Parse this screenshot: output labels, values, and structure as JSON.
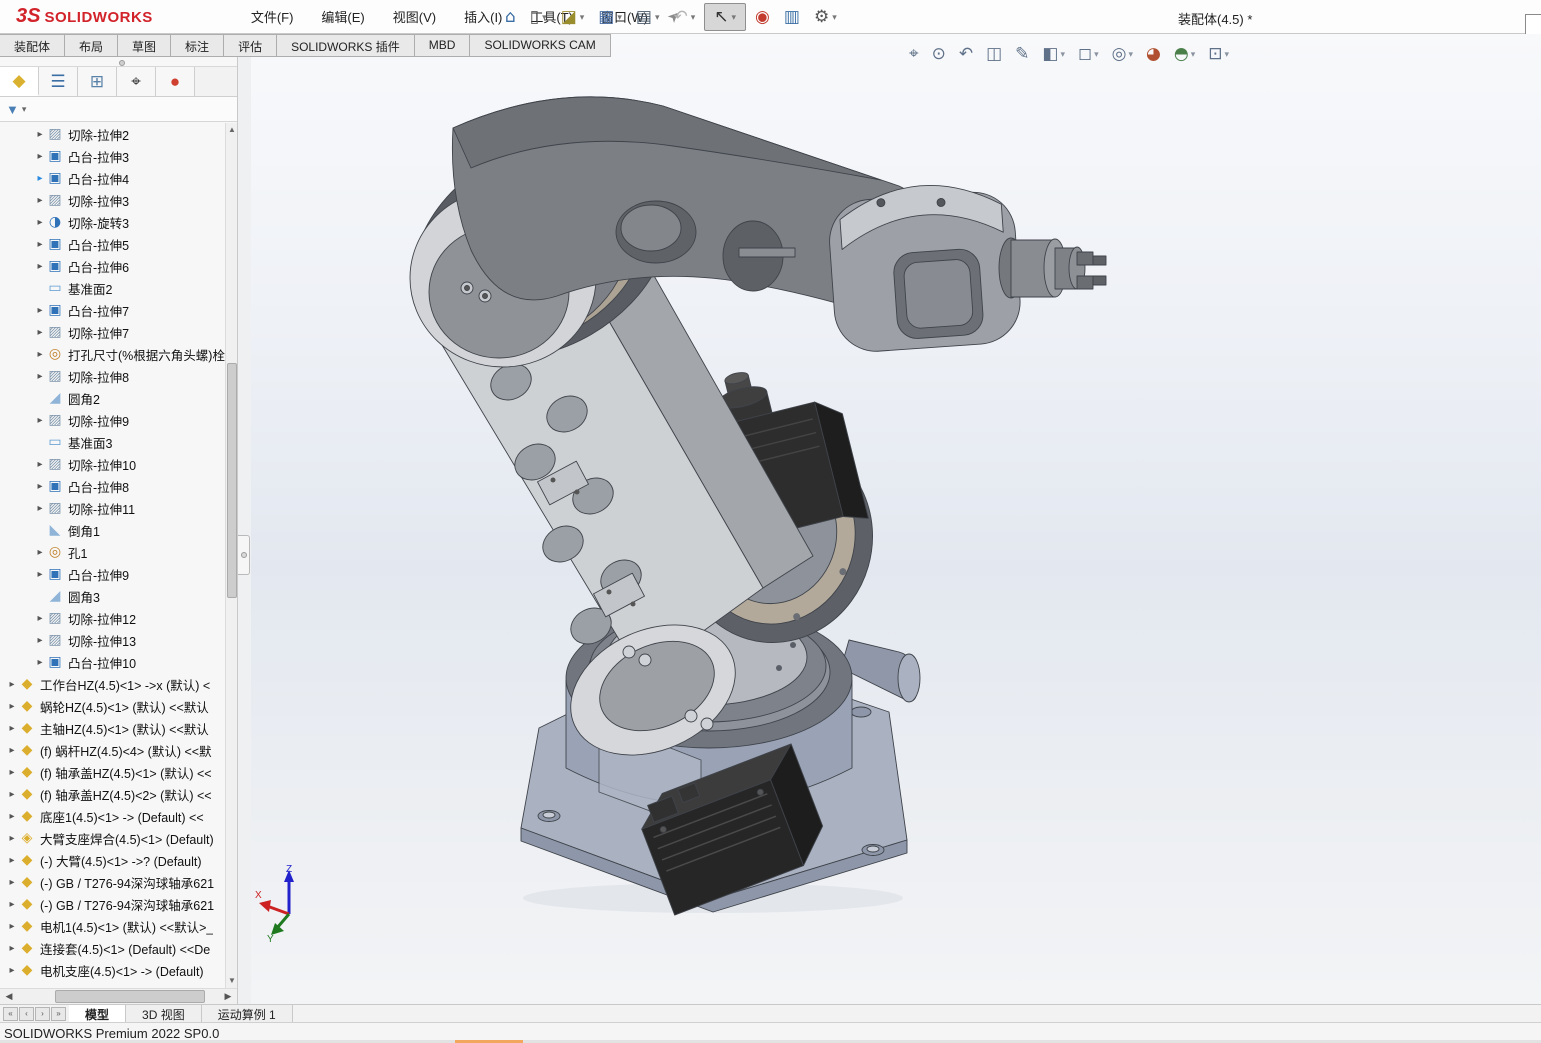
{
  "app": {
    "logo_mark": "3S",
    "logo_word": "SOLIDWORKS",
    "doc_title": "装配体(4.5) *",
    "status_text": "SOLIDWORKS Premium 2022 SP0.0",
    "accent_red": "#d2232a",
    "taskbar_accent": "#f2a65e"
  },
  "menu": {
    "items": [
      {
        "label": "文件(F)"
      },
      {
        "label": "编辑(E)"
      },
      {
        "label": "视图(V)"
      },
      {
        "label": "插入(I)"
      },
      {
        "label": "工具(T)"
      },
      {
        "label": "窗口(W)"
      }
    ],
    "pin_icon": "pin"
  },
  "quick_toolbar": {
    "buttons": [
      {
        "name": "home",
        "glyph": "⌂",
        "color": "#3a6ea5",
        "dropdown": false
      },
      {
        "name": "new-document",
        "glyph": "▯",
        "color": "#5a5a5a",
        "dropdown": true
      },
      {
        "name": "open-folder",
        "glyph": "◪",
        "color": "#9a8d2e",
        "dropdown": true
      },
      {
        "name": "save",
        "glyph": "▦",
        "color": "#4a6fa5",
        "dropdown": true
      },
      {
        "name": "print",
        "glyph": "▤",
        "color": "#49596b",
        "dropdown": true
      },
      {
        "name": "undo",
        "glyph": "↶",
        "color": "#b4b4b4",
        "dropdown": true
      },
      {
        "name": "select-cursor",
        "glyph": "↖",
        "color": "#333333",
        "dropdown": true,
        "selected": true
      },
      {
        "name": "traffic-light",
        "glyph": "◉",
        "color": "#c23b2e",
        "dropdown": false
      },
      {
        "name": "properties-list",
        "glyph": "▥",
        "color": "#3a6ea5",
        "dropdown": false
      },
      {
        "name": "settings-gear",
        "glyph": "⚙",
        "color": "#555555",
        "dropdown": true
      }
    ]
  },
  "ribbon": {
    "tabs": [
      {
        "label": "装配体"
      },
      {
        "label": "布局"
      },
      {
        "label": "草图"
      },
      {
        "label": "标注"
      },
      {
        "label": "评估"
      },
      {
        "label": "SOLIDWORKS 插件"
      },
      {
        "label": "MBD"
      },
      {
        "label": "SOLIDWORKS CAM"
      }
    ]
  },
  "panel": {
    "tabs": [
      {
        "name": "featuremanager-tree-tab",
        "glyph": "◆",
        "color": "#d9b12e",
        "active": true
      },
      {
        "name": "propertymanager-tab",
        "glyph": "☰",
        "color": "#3a6ea5",
        "active": false
      },
      {
        "name": "configurationmanager-tab",
        "glyph": "⊞",
        "color": "#5a82a8",
        "active": false
      },
      {
        "name": "dimxpertmanager-tab",
        "glyph": "⌖",
        "color": "#333333",
        "active": false
      },
      {
        "name": "displaymanager-tab",
        "glyph": "●",
        "color": "#d04030",
        "active": false
      }
    ],
    "tab_arrows": {
      "left": "◂",
      "right": "▸"
    },
    "filter": {
      "funnel_glyph": "▼",
      "caret": "▾"
    },
    "scroll": {
      "up": "▲",
      "down": "▼",
      "left": "◀",
      "right": "▶"
    }
  },
  "tree": {
    "items": [
      {
        "label": "切除-拉伸2",
        "icon": "cut-extrude-icon",
        "glyph": "▨",
        "color": "#7d95ab",
        "arrow": true,
        "level": 2
      },
      {
        "label": "凸台-拉伸3",
        "icon": "boss-extrude-icon",
        "glyph": "▣",
        "color": "#2f72b8",
        "arrow": true,
        "level": 2
      },
      {
        "label": "凸台-拉伸4",
        "icon": "boss-extrude-icon",
        "glyph": "▣",
        "color": "#2f72b8",
        "arrow": true,
        "level": 2,
        "arrow_highlight": true
      },
      {
        "label": "切除-拉伸3",
        "icon": "cut-extrude-icon",
        "glyph": "▨",
        "color": "#7d95ab",
        "arrow": true,
        "level": 2
      },
      {
        "label": "切除-旋转3",
        "icon": "revolve-cut-icon",
        "glyph": "◑",
        "color": "#2f72b8",
        "arrow": true,
        "level": 2
      },
      {
        "label": "凸台-拉伸5",
        "icon": "boss-extrude-icon",
        "glyph": "▣",
        "color": "#2f72b8",
        "arrow": true,
        "level": 2
      },
      {
        "label": "凸台-拉伸6",
        "icon": "boss-extrude-icon",
        "glyph": "▣",
        "color": "#2f72b8",
        "arrow": true,
        "level": 2
      },
      {
        "label": "基准面2",
        "icon": "plane-icon",
        "glyph": "▭",
        "color": "#5c9bd1",
        "arrow": false,
        "level": 2
      },
      {
        "label": "凸台-拉伸7",
        "icon": "boss-extrude-icon",
        "glyph": "▣",
        "color": "#2f72b8",
        "arrow": true,
        "level": 2
      },
      {
        "label": "切除-拉伸7",
        "icon": "cut-extrude-icon",
        "glyph": "▨",
        "color": "#7d95ab",
        "arrow": true,
        "level": 2
      },
      {
        "label": "打孔尺寸(%根据六角头螺)栓",
        "icon": "hole-wizard-icon",
        "glyph": "◎",
        "color": "#c07f28",
        "arrow": true,
        "level": 2
      },
      {
        "label": "切除-拉伸8",
        "icon": "cut-extrude-icon",
        "glyph": "▨",
        "color": "#7d95ab",
        "arrow": true,
        "level": 2
      },
      {
        "label": "圆角2",
        "icon": "fillet-icon",
        "glyph": "◢",
        "color": "#8fb4d8",
        "arrow": false,
        "level": 2
      },
      {
        "label": "切除-拉伸9",
        "icon": "cut-extrude-icon",
        "glyph": "▨",
        "color": "#7d95ab",
        "arrow": true,
        "level": 2
      },
      {
        "label": "基准面3",
        "icon": "plane-icon",
        "glyph": "▭",
        "color": "#5c9bd1",
        "arrow": false,
        "level": 2
      },
      {
        "label": "切除-拉伸10",
        "icon": "cut-extrude-icon",
        "glyph": "▨",
        "color": "#7d95ab",
        "arrow": true,
        "level": 2
      },
      {
        "label": "凸台-拉伸8",
        "icon": "boss-extrude-icon",
        "glyph": "▣",
        "color": "#2f72b8",
        "arrow": true,
        "level": 2
      },
      {
        "label": "切除-拉伸11",
        "icon": "cut-extrude-icon",
        "glyph": "▨",
        "color": "#7d95ab",
        "arrow": true,
        "level": 2
      },
      {
        "label": "倒角1",
        "icon": "chamfer-icon",
        "glyph": "◣",
        "color": "#8fb4d8",
        "arrow": false,
        "level": 2
      },
      {
        "label": "孔1",
        "icon": "hole-wizard-icon",
        "glyph": "◎",
        "color": "#c07f28",
        "arrow": true,
        "level": 2
      },
      {
        "label": "凸台-拉伸9",
        "icon": "boss-extrude-icon",
        "glyph": "▣",
        "color": "#2f72b8",
        "arrow": true,
        "level": 2
      },
      {
        "label": "圆角3",
        "icon": "fillet-icon",
        "glyph": "◢",
        "color": "#8fb4d8",
        "arrow": false,
        "level": 2
      },
      {
        "label": "切除-拉伸12",
        "icon": "cut-extrude-icon",
        "glyph": "▨",
        "color": "#7d95ab",
        "arrow": true,
        "level": 2
      },
      {
        "label": "切除-拉伸13",
        "icon": "cut-extrude-icon",
        "glyph": "▨",
        "color": "#7d95ab",
        "arrow": true,
        "level": 2
      },
      {
        "label": "凸台-拉伸10",
        "icon": "boss-extrude-icon",
        "glyph": "▣",
        "color": "#2f72b8",
        "arrow": true,
        "level": 2
      },
      {
        "label": "工作台HZ(4.5)<1> ->x (默认) <",
        "icon": "component-icon",
        "glyph": "◆",
        "color": "#dcae2e",
        "arrow": true,
        "level": 1
      },
      {
        "label": "蜗轮HZ(4.5)<1> (默认) <<默认",
        "icon": "component-icon",
        "glyph": "◆",
        "color": "#dcae2e",
        "arrow": true,
        "level": 1
      },
      {
        "label": "主轴HZ(4.5)<1> (默认) <<默认",
        "icon": "component-icon",
        "glyph": "◆",
        "color": "#dcae2e",
        "arrow": true,
        "level": 1
      },
      {
        "label": "(f) 蜗杆HZ(4.5)<4> (默认) <<默",
        "icon": "component-icon",
        "glyph": "◆",
        "color": "#dcae2e",
        "arrow": true,
        "level": 1
      },
      {
        "label": "(f) 轴承盖HZ(4.5)<1> (默认) <<",
        "icon": "component-icon",
        "glyph": "◆",
        "color": "#dcae2e",
        "arrow": true,
        "level": 1
      },
      {
        "label": "(f) 轴承盖HZ(4.5)<2> (默认) <<",
        "icon": "component-icon",
        "glyph": "◆",
        "color": "#dcae2e",
        "arrow": true,
        "level": 1
      },
      {
        "label": "底座1(4.5)<1> -> (Default) <<",
        "icon": "component-icon",
        "glyph": "◆",
        "color": "#dcae2e",
        "arrow": true,
        "level": 1
      },
      {
        "label": "大臂支座焊合(4.5)<1> (Default)",
        "icon": "weldment-component-icon",
        "glyph": "◈",
        "color": "#dcae2e",
        "arrow": true,
        "level": 1
      },
      {
        "label": "(-) 大臂(4.5)<1> ->? (Default)",
        "icon": "component-icon",
        "glyph": "◆",
        "color": "#dcae2e",
        "arrow": true,
        "level": 1
      },
      {
        "label": "(-) GB / T276-94深沟球轴承621",
        "icon": "component-icon",
        "glyph": "◆",
        "color": "#dcae2e",
        "arrow": true,
        "level": 1
      },
      {
        "label": "(-) GB / T276-94深沟球轴承621",
        "icon": "component-icon",
        "glyph": "◆",
        "color": "#dcae2e",
        "arrow": true,
        "level": 1
      },
      {
        "label": "电机1(4.5)<1> (默认) <<默认>_",
        "icon": "component-icon",
        "glyph": "◆",
        "color": "#dcae2e",
        "arrow": true,
        "level": 1
      },
      {
        "label": "连接套(4.5)<1> (Default) <<De",
        "icon": "component-icon",
        "glyph": "◆",
        "color": "#dcae2e",
        "arrow": true,
        "level": 1
      },
      {
        "label": "电机支座(4.5)<1> -> (Default)",
        "icon": "component-icon",
        "glyph": "◆",
        "color": "#dcae2e",
        "arrow": true,
        "level": 1
      }
    ]
  },
  "hud": {
    "buttons": [
      {
        "name": "zoom-fit",
        "glyph": "⌖",
        "color": "#5f7188",
        "dropdown": false
      },
      {
        "name": "zoom-area",
        "glyph": "⊙",
        "color": "#5f7188",
        "dropdown": false
      },
      {
        "name": "previous-view",
        "glyph": "↶",
        "color": "#5f7188",
        "dropdown": false
      },
      {
        "name": "section-view",
        "glyph": "◫",
        "color": "#5f7188",
        "dropdown": false
      },
      {
        "name": "dynamic-annotation-views",
        "glyph": "✎",
        "color": "#5f7188",
        "dropdown": false
      },
      {
        "name": "view-orientation",
        "glyph": "◧",
        "color": "#5f7188",
        "dropdown": true
      },
      {
        "name": "display-style",
        "glyph": "◻",
        "color": "#5f7188",
        "dropdown": true
      },
      {
        "name": "hide-show-items",
        "glyph": "◎",
        "color": "#5f7188",
        "dropdown": true
      },
      {
        "name": "edit-appearance",
        "glyph": "◕",
        "color": "#b05030",
        "dropdown": false
      },
      {
        "name": "apply-scene",
        "glyph": "◓",
        "color": "#4a7f4a",
        "dropdown": true
      },
      {
        "name": "view-settings",
        "glyph": "⊡",
        "color": "#5f7188",
        "dropdown": true
      }
    ]
  },
  "triad": {
    "x_label": "X",
    "y_label": "Y",
    "z_label": "Z",
    "x_color": "#cc2222",
    "y_color": "#1f7a1f",
    "z_color": "#2222cc"
  },
  "bottom": {
    "nav_buttons": [
      "«",
      "‹",
      "›",
      "»"
    ],
    "tabs": [
      {
        "label": "模型",
        "active": true
      },
      {
        "label": "3D 视图",
        "active": false
      },
      {
        "label": "运动算例 1",
        "active": false
      }
    ]
  }
}
